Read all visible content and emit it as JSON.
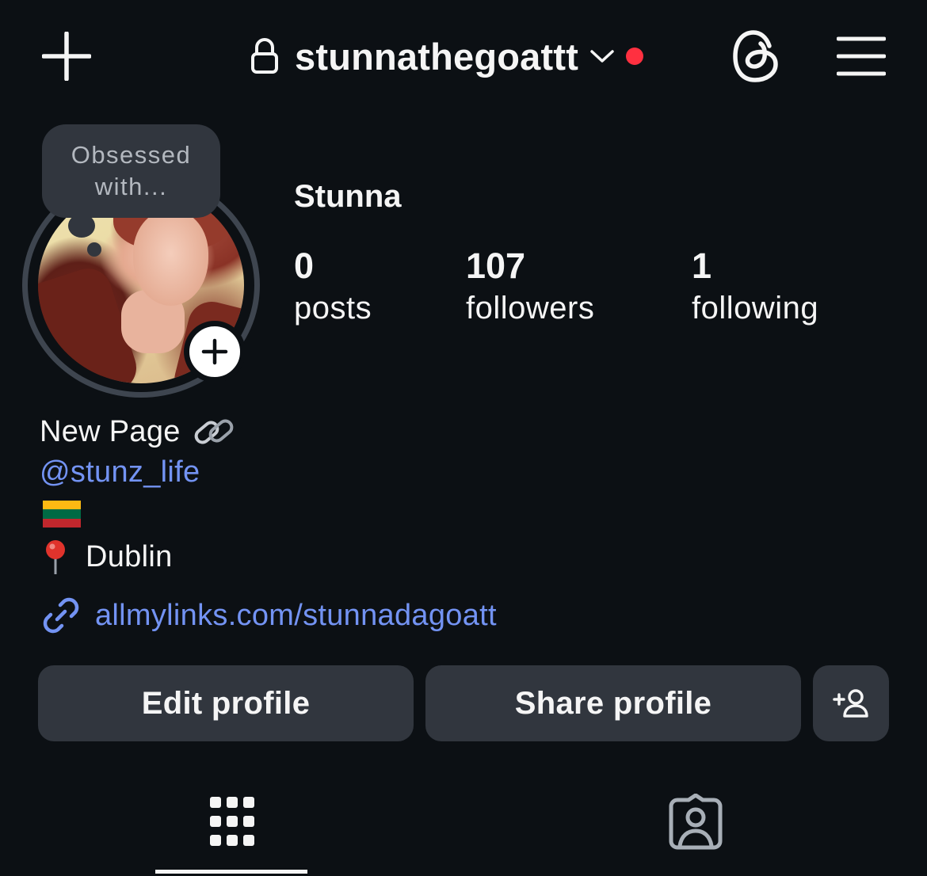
{
  "header": {
    "username": "stunnathegoattt",
    "new_post_icon": "plus-icon",
    "lock_icon": "lock-icon",
    "switch_icon": "chevron-down-icon",
    "notification_dot_color": "#ff3040",
    "threads_icon": "threads-icon",
    "menu_icon": "hamburger-menu-icon"
  },
  "profile": {
    "display_name": "Stunna",
    "note": {
      "line1": "Obsessed",
      "line2": "with..."
    },
    "stats": {
      "posts": {
        "count": "0",
        "label": "posts"
      },
      "followers": {
        "count": "107",
        "label": "followers"
      },
      "following": {
        "count": "1",
        "label": "following"
      }
    },
    "bio": {
      "title": "New Page",
      "title_emoji": "link-emoji",
      "handle": "@stunz_life",
      "flag": "lithuania-flag",
      "location_emoji": "round-pushpin",
      "location": "Dublin",
      "link": "allmylinks.com/stunnadagoatt"
    }
  },
  "actions": {
    "edit_label": "Edit profile",
    "share_label": "Share profile",
    "add_person_icon": "add-person-icon"
  },
  "tabs": [
    {
      "name": "posts-grid",
      "icon": "grid-icon",
      "active": true
    },
    {
      "name": "tagged",
      "icon": "tagged-person-icon",
      "active": false
    }
  ],
  "colors": {
    "background": "#0c1014",
    "button": "#31363e",
    "link": "#7393f3",
    "text": "#f5f5f5"
  }
}
